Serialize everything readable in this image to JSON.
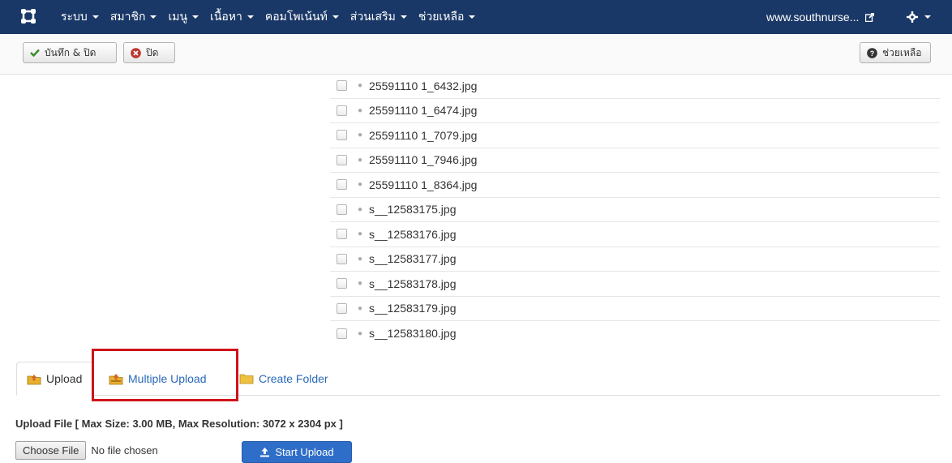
{
  "navbar": {
    "menu": [
      {
        "label": "ระบบ"
      },
      {
        "label": "สมาชิก"
      },
      {
        "label": "เมนู"
      },
      {
        "label": "เนื้อหา"
      },
      {
        "label": "คอมโพเน้นท์"
      },
      {
        "label": "ส่วนเสริม"
      },
      {
        "label": "ช่วยเหลือ"
      }
    ],
    "site_link": "www.southnurse...",
    "bg_color": "#1a3867"
  },
  "toolbar": {
    "save_close_label": "บันทึก & ปิด",
    "close_label": "ปิด",
    "help_label": "ช่วยเหลือ"
  },
  "files": [
    "25591110 1_6432.jpg",
    "25591110 1_6474.jpg",
    "25591110 1_7079.jpg",
    "25591110 1_7946.jpg",
    "25591110 1_8364.jpg",
    "s__12583175.jpg",
    "s__12583176.jpg",
    "s__12583177.jpg",
    "s__12583178.jpg",
    "s__12583179.jpg",
    "s__12583180.jpg"
  ],
  "tabs": {
    "upload": "Upload",
    "multiple_upload": "Multiple Upload",
    "create_folder": "Create Folder"
  },
  "upload": {
    "title": "Upload File [ Max Size: 3.00 MB, Max Resolution: 3072 x 2304 px ]",
    "choose_file": "Choose File",
    "no_file": "No file chosen",
    "start_upload": "Start Upload"
  },
  "colors": {
    "accent": "#2f6ec8",
    "highlight": "#d0131b",
    "link": "#2a69b8"
  }
}
